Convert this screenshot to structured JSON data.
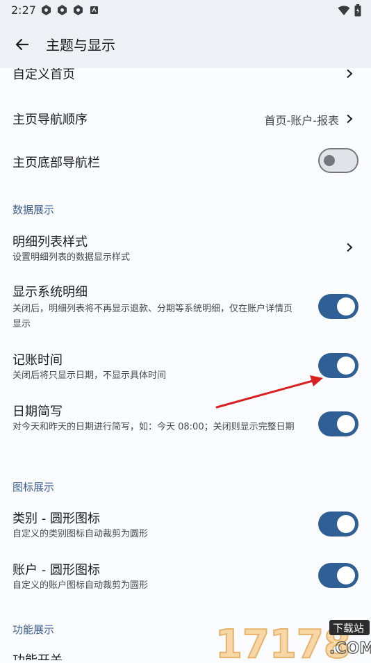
{
  "status": {
    "time": "2:27"
  },
  "appbar": {
    "title": "主题与显示"
  },
  "rows": {
    "custom_home": "自定义首页",
    "nav_order": {
      "title": "主页导航顺序",
      "value": "首页-账户-报表"
    },
    "bottom_nav": {
      "title": "主页底部导航栏",
      "on": false
    },
    "section_data": "数据展示",
    "detail_style": {
      "title": "明细列表样式",
      "sub": "设置明细列表的数据显示样式"
    },
    "system_detail": {
      "title": "显示系统明细",
      "sub": "关闭后，明细列表将不再显示退款、分期等系统明细，仅在账户详情页显示",
      "on": true
    },
    "record_time": {
      "title": "记账时间",
      "sub": "关闭后将只显示日期，不显示具体时间",
      "on": true
    },
    "date_short": {
      "title": "日期简写",
      "sub": "对今天和昨天的日期进行简写，如：今天 08:00；关闭则显示完整日期",
      "on": true
    },
    "section_icon": "图标展示",
    "category_icon": {
      "title": "类别 - 圆形图标",
      "sub": "自定义的类别图标自动裁剪为圆形",
      "on": true
    },
    "account_icon": {
      "title": "账户 - 圆形图标",
      "sub": "自定义的账户图标自动裁剪为圆形",
      "on": true
    },
    "section_func": "功能展示",
    "func_switch": "功能开关"
  },
  "watermark": {
    "text": "17178",
    "badge": "下载站",
    "domain": ".COM"
  },
  "colors": {
    "accent": "#2f5f94",
    "section": "#3b5d8f",
    "annotation": "#d92020"
  }
}
